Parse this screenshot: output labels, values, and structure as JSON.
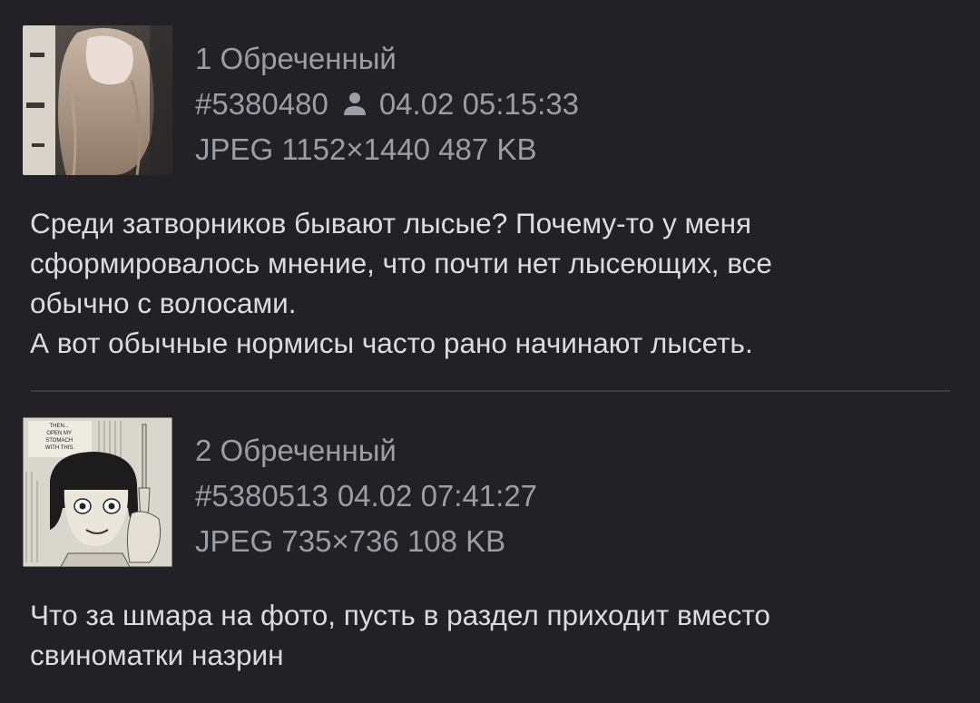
{
  "posts": [
    {
      "number": "1",
      "author": "Обреченный",
      "post_id": "#5380480",
      "has_op_icon": true,
      "op_icon": "person-icon",
      "datetime": "04.02 05:15:33",
      "file_type": "JPEG",
      "file_dims": "1152×1440",
      "file_size": "487 KB",
      "comment": "Среди затворников бывают лысые? Почему-то у меня\nсформировалось мнение, что почти нет лысеющих, все\nобычно с волосами.\nА вот обычные нормисы часто рано начинают лысеть."
    },
    {
      "number": "2",
      "author": "Обреченный",
      "post_id": "#5380513",
      "has_op_icon": false,
      "datetime": "04.02 07:41:27",
      "file_type": "JPEG",
      "file_dims": "735×736",
      "file_size": "108 KB",
      "thumb_caption": "THEN... OPEN MY STOMACH WITH THIS.",
      "comment": "Что за шмара на фото, пусть в раздел приходит вместо\nсвиноматки назрин"
    }
  ],
  "colors": {
    "background": "#212126",
    "meta_text": "#9d9da4",
    "body_text": "#dcdcdc",
    "divider": "#3a3a42"
  }
}
